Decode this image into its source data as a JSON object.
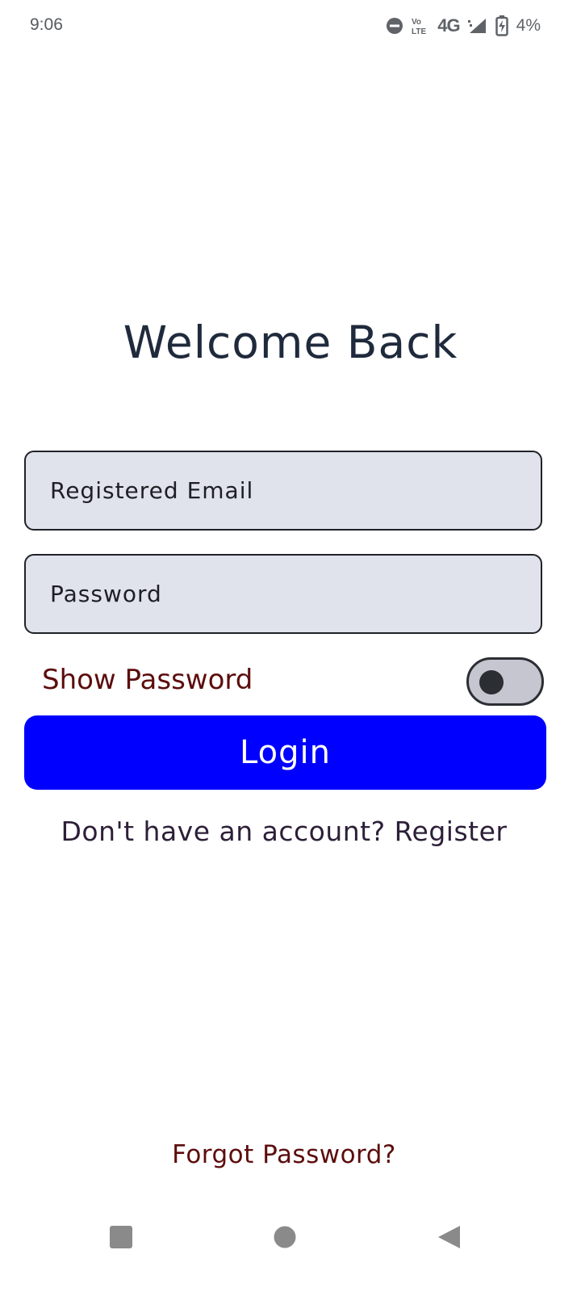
{
  "status_bar": {
    "time": "9:06",
    "network": "4G",
    "battery_percent": "4%",
    "icons": [
      "do-not-disturb-icon",
      "volte-icon",
      "signal-icon",
      "battery-charging-icon"
    ]
  },
  "login": {
    "title": "Welcome Back",
    "email_placeholder": "Registered Email",
    "password_placeholder": "Password",
    "show_password_label": "Show Password",
    "show_password_enabled": false,
    "login_button_label": "Login",
    "register_prompt": "Don't have an account? Register",
    "forgot_password_label": "Forgot Password?"
  },
  "colors": {
    "accent": "#0000ff",
    "field_background": "#e0e3ec",
    "link_text": "#5c0d0d",
    "title_text": "#1f2a3c"
  },
  "nav_bar": {
    "buttons": [
      "recent-apps-icon",
      "home-icon",
      "back-icon"
    ]
  }
}
